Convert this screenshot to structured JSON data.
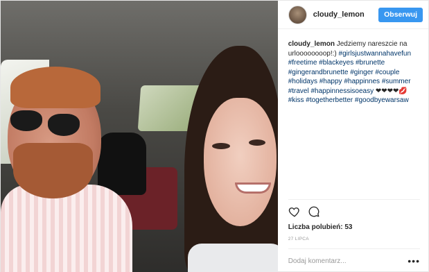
{
  "header": {
    "username": "cloudy_lemon",
    "follow_label": "Obserwuj"
  },
  "caption": {
    "username": "cloudy_lemon",
    "text_start": "Jedziemy nareszcie na urloooooooop!:)",
    "hashtags_a": [
      "#girlsjustwannahavefun",
      "#freetime",
      "#blackeyes",
      "#brunette",
      "#gingerandbrunette",
      "#ginger",
      "#couple",
      "#holidays",
      "#happy",
      "#happinnes",
      "#summer",
      "#travel",
      "#happinnessisoeasy"
    ],
    "emoji": "❤❤❤❤💋",
    "hashtags_b": [
      "#kiss",
      "#togetherbetter",
      "#goodbyewarsaw"
    ]
  },
  "actions": {
    "like_icon": "heart-icon",
    "comment_icon": "comment-bubble-icon"
  },
  "likes_text": "Liczba polubień: 53",
  "date_text": "27 LIPCA",
  "comment_field": {
    "placeholder": "Dodaj komentarz...",
    "more_icon": "ellipsis-icon"
  },
  "colors": {
    "follow_button": "#3897f0",
    "hashtag": "#003569"
  }
}
